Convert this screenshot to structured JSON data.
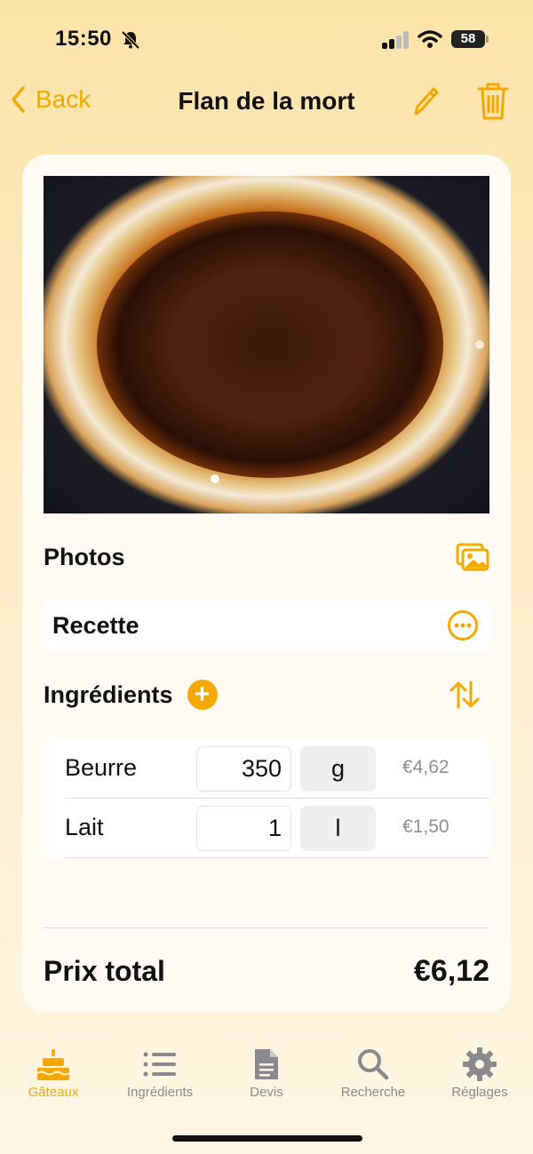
{
  "status": {
    "time": "15:50",
    "battery": "58"
  },
  "nav": {
    "back_label": "Back",
    "title": "Flan de la mort"
  },
  "card": {
    "photos_label": "Photos",
    "recette_label": "Recette",
    "ingredients_label": "Ingrédients",
    "photo_pages": 2,
    "ingredients": [
      {
        "name": "Beurre",
        "quantity": "350",
        "unit": "g",
        "price": "€4,62"
      },
      {
        "name": "Lait",
        "quantity": "1",
        "unit": "l",
        "price": "€1,50"
      }
    ],
    "total_label": "Prix total",
    "total_value": "€6,12"
  },
  "tabs": [
    {
      "label": "Gâteaux",
      "icon": "cake-icon",
      "active": true
    },
    {
      "label": "Ingrédients",
      "icon": "list-icon",
      "active": false
    },
    {
      "label": "Devis",
      "icon": "document-icon",
      "active": false
    },
    {
      "label": "Recherche",
      "icon": "search-icon",
      "active": false
    },
    {
      "label": "Réglages",
      "icon": "gear-icon",
      "active": false
    }
  ],
  "colors": {
    "accent": "#F4A800",
    "inactive": "#8a8a8e"
  }
}
